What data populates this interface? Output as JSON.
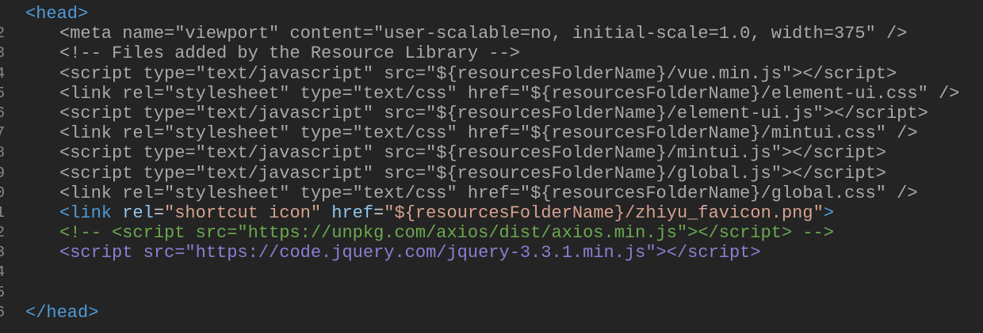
{
  "editor": {
    "lines": [
      {
        "num": "",
        "indent": 0,
        "tokens": [
          {
            "t": "<head>",
            "c": "tag"
          }
        ]
      },
      {
        "num": "2",
        "indent": 1,
        "tokens": [
          {
            "t": "<meta name=\"viewport\" content=\"user-scalable=no, initial-scale=1.0, width=375\" />",
            "c": "dim"
          }
        ]
      },
      {
        "num": "3",
        "indent": 1,
        "tokens": [
          {
            "t": "<!-- Files added by the Resource Library -->",
            "c": "dim"
          }
        ]
      },
      {
        "num": "4",
        "indent": 1,
        "tokens": [
          {
            "t": "<script type=\"text/javascript\" src=\"${resourcesFolderName}/vue.min.js\"></script>",
            "c": "dim"
          }
        ]
      },
      {
        "num": "5",
        "indent": 1,
        "tokens": [
          {
            "t": "<link rel=\"stylesheet\" type=\"text/css\" href=\"${resourcesFolderName}/element-ui.css\" />",
            "c": "dim"
          }
        ]
      },
      {
        "num": "6",
        "indent": 1,
        "tokens": [
          {
            "t": "<script type=\"text/javascript\" src=\"${resourcesFolderName}/element-ui.js\"></script>",
            "c": "dim"
          }
        ]
      },
      {
        "num": "7",
        "indent": 1,
        "tokens": [
          {
            "t": "<link rel=\"stylesheet\" type=\"text/css\" href=\"${resourcesFolderName}/mintui.css\" />",
            "c": "dim"
          }
        ]
      },
      {
        "num": "8",
        "indent": 1,
        "tokens": [
          {
            "t": "<script type=\"text/javascript\" src=\"${resourcesFolderName}/mintui.js\"></script>",
            "c": "dim"
          }
        ]
      },
      {
        "num": "9",
        "indent": 1,
        "tokens": [
          {
            "t": "<script type=\"text/javascript\" src=\"${resourcesFolderName}/global.js\"></script>",
            "c": "dim"
          }
        ]
      },
      {
        "num": "0",
        "indent": 1,
        "tokens": [
          {
            "t": "<link rel=\"stylesheet\" type=\"text/css\" href=\"${resourcesFolderName}/global.css\" />",
            "c": "dim"
          }
        ]
      },
      {
        "num": "1",
        "indent": 1,
        "tokens": [
          {
            "t": "<link",
            "c": "tag"
          },
          {
            "t": " ",
            "c": "plain"
          },
          {
            "t": "rel",
            "c": "attr"
          },
          {
            "t": "=",
            "c": "plain"
          },
          {
            "t": "\"shortcut icon\"",
            "c": "str"
          },
          {
            "t": " ",
            "c": "plain"
          },
          {
            "t": "href",
            "c": "attr"
          },
          {
            "t": "=",
            "c": "plain"
          },
          {
            "t": "\"${resourcesFolderName}/zhiyu_favicon.png\"",
            "c": "str"
          },
          {
            "t": ">",
            "c": "tag"
          }
        ]
      },
      {
        "num": "2",
        "indent": 1,
        "tokens": [
          {
            "t": "<!-- <script src=\"https://unpkg.com/axios/dist/axios.min.js\"></script> -->",
            "c": "comment"
          }
        ]
      },
      {
        "num": "3",
        "indent": 1,
        "tokens": [
          {
            "t": "<script src=\"https://code.jquery.com/jquery-3.3.1.min.js\"></script>",
            "c": "purple"
          }
        ]
      },
      {
        "num": "4",
        "indent": 0,
        "tokens": []
      },
      {
        "num": "5",
        "indent": 0,
        "tokens": []
      },
      {
        "num": "6",
        "indent": 0,
        "tokens": [
          {
            "t": "</head>",
            "c": "tag"
          }
        ]
      }
    ]
  }
}
